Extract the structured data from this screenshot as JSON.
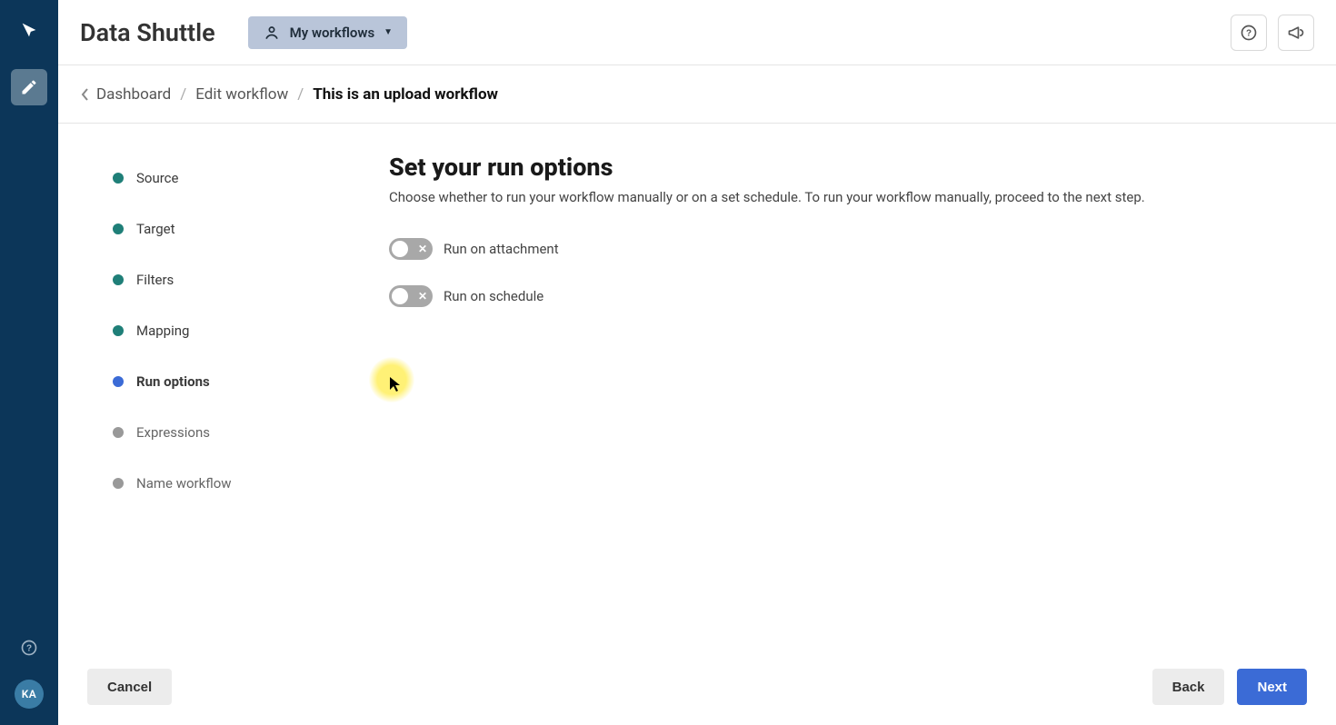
{
  "app_title": "Data Shuttle",
  "workflow_selector_label": "My workflows",
  "breadcrumb": {
    "items": [
      {
        "label": "Dashboard"
      },
      {
        "label": "Edit workflow"
      },
      {
        "label": "This is an upload workflow"
      }
    ]
  },
  "steps": [
    {
      "label": "Source",
      "state": "complete"
    },
    {
      "label": "Target",
      "state": "complete"
    },
    {
      "label": "Filters",
      "state": "complete"
    },
    {
      "label": "Mapping",
      "state": "complete"
    },
    {
      "label": "Run options",
      "state": "active"
    },
    {
      "label": "Expressions",
      "state": "pending"
    },
    {
      "label": "Name workflow",
      "state": "pending"
    }
  ],
  "content": {
    "heading": "Set your run options",
    "subtitle": "Choose whether to run your workflow manually or on a set schedule. To run your workflow manually, proceed to the next step.",
    "toggles": [
      {
        "label": "Run on attachment",
        "on": false
      },
      {
        "label": "Run on schedule",
        "on": false
      }
    ]
  },
  "footer": {
    "cancel": "Cancel",
    "back": "Back",
    "next": "Next"
  },
  "avatar_initials": "KA"
}
